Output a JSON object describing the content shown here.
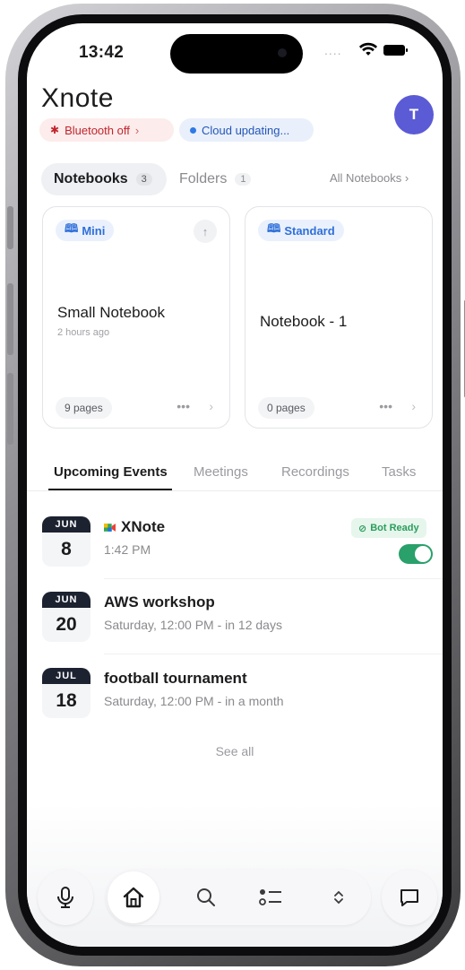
{
  "status_bar": {
    "time": "13:42",
    "signal": "....",
    "wifi_icon": "wifi-icon",
    "battery_icon": "battery-icon"
  },
  "header": {
    "app_name": "Xnote",
    "avatar_initial": "T",
    "avatar_color": "#5b5bd6"
  },
  "status_pills": {
    "bluetooth": {
      "label": "Bluetooth off",
      "icon": "bluetooth-off-icon",
      "chevron": "›"
    },
    "cloud": {
      "label": "Cloud updating..."
    }
  },
  "notebook_tabs": {
    "notebooks": {
      "label": "Notebooks",
      "count": "3"
    },
    "folders": {
      "label": "Folders",
      "count": "1"
    },
    "all_notebooks": "All Notebooks ›"
  },
  "notebooks": [
    {
      "badge": "Mini",
      "title": "Small Notebook",
      "subtitle": "2 hours ago",
      "pages": "9 pages",
      "more": "•••",
      "chevron": "›",
      "pin": "↑"
    },
    {
      "badge": "Standard",
      "title": "Notebook - 1",
      "subtitle": "",
      "pages": "0 pages",
      "more": "•••",
      "chevron": "›"
    }
  ],
  "section_tabs": {
    "upcoming": "Upcoming Events",
    "meetings": "Meetings",
    "recordings": "Recordings",
    "tasks": "Tasks"
  },
  "events": [
    {
      "month": "JUN",
      "day": "8",
      "title": "XNote",
      "subtitle": "1:42 PM",
      "bot_ready": "Bot Ready",
      "toggle_on": true
    },
    {
      "month": "JUN",
      "day": "20",
      "title": "AWS workshop",
      "subtitle": "Saturday, 12:00 PM - in 12 days"
    },
    {
      "month": "JUL",
      "day": "18",
      "title": "football tournament",
      "subtitle": "Saturday, 12:00 PM - in a month"
    }
  ],
  "see_all": "See all",
  "bottom_nav": {
    "items": [
      "mic-icon",
      "home-icon",
      "search-icon",
      "checklist-icon",
      "expand-icon",
      "chat-icon"
    ],
    "active": "home-icon"
  },
  "colors": {
    "bluetooth_red": "#c0262d",
    "cloud_blue": "#2456b8",
    "bot_ready_green": "#2aa06a",
    "accent_blue": "#2f6fd8"
  }
}
